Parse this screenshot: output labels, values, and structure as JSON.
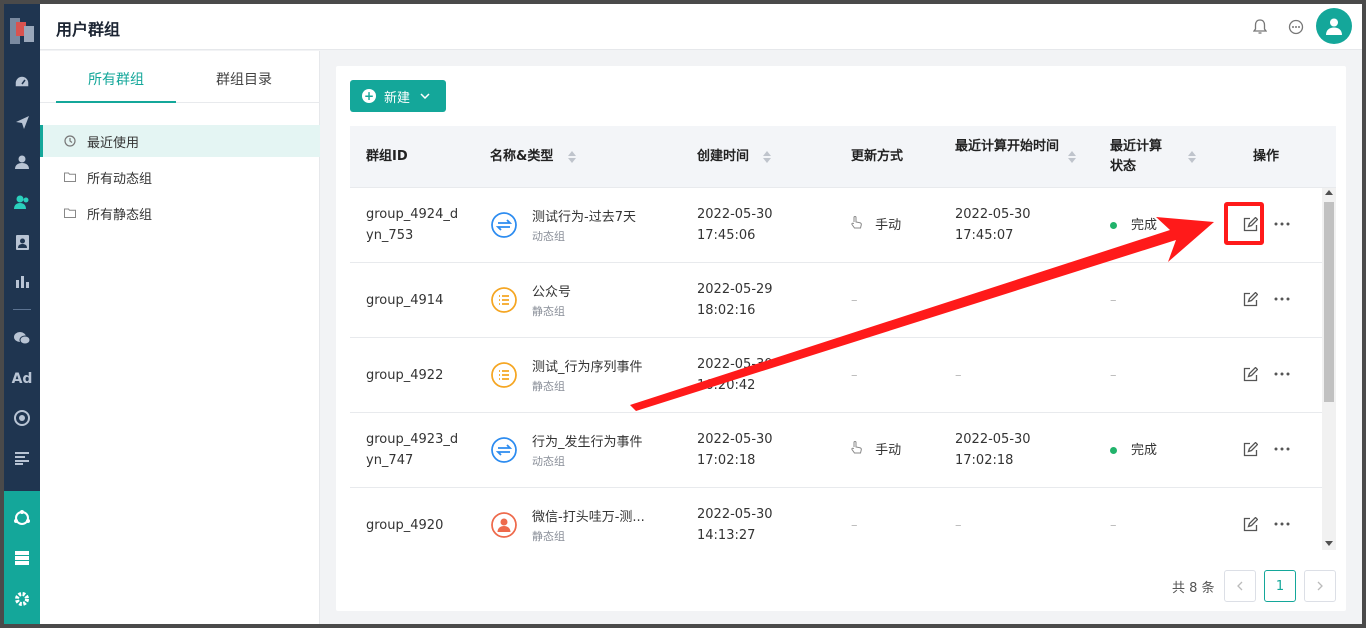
{
  "header": {
    "title": "用户群组"
  },
  "side": {
    "tabs": [
      {
        "label": "所有群组"
      },
      {
        "label": "群组目录"
      }
    ],
    "items": [
      {
        "label": "最近使用"
      },
      {
        "label": "所有动态组"
      },
      {
        "label": "所有静态组"
      }
    ]
  },
  "toolbar": {
    "new_label": "新建"
  },
  "table": {
    "headers": [
      "群组ID",
      "名称&类型",
      "创建时间",
      "更新方式",
      "最近计算开始时间",
      "最近计算状态",
      "操作"
    ],
    "rows": [
      {
        "id_l1": "group_4924_d",
        "id_l2": "yn_753",
        "name": "测试行为-过去7天",
        "type": "动态组",
        "icon": "sync-icon",
        "date": "2022-05-30",
        "time": "17:45:06",
        "update": "手动",
        "calc_date": "2022-05-30",
        "calc_time": "17:45:07",
        "status": "完成"
      },
      {
        "id_l1": "group_4914",
        "id_l2": "",
        "name": "公众号",
        "type": "静态组",
        "icon": "list-icon",
        "date": "2022-05-29",
        "time": "18:02:16",
        "update": "–",
        "calc_date": "–",
        "calc_time": "",
        "status": "–"
      },
      {
        "id_l1": "group_4922",
        "id_l2": "",
        "name": "测试_行为序列事件",
        "type": "静态组",
        "icon": "list-icon",
        "date": "2022-05-30",
        "time": "16:20:42",
        "update": "–",
        "calc_date": "–",
        "calc_time": "",
        "status": "–"
      },
      {
        "id_l1": "group_4923_d",
        "id_l2": "yn_747",
        "name": "行为_发生行为事件",
        "type": "动态组",
        "icon": "sync-icon",
        "date": "2022-05-30",
        "time": "17:02:18",
        "update": "手动",
        "calc_date": "2022-05-30",
        "calc_time": "17:02:18",
        "status": "完成"
      },
      {
        "id_l1": "group_4920",
        "id_l2": "",
        "name": "微信-打头哇万-测...",
        "type": "静态组",
        "icon": "person-icon",
        "date": "2022-05-30",
        "time": "14:13:27",
        "update": "–",
        "calc_date": "–",
        "calc_time": "",
        "status": "–"
      }
    ]
  },
  "pagination": {
    "total": "共 8 条",
    "current": "1"
  },
  "colors": {
    "accent": "#14a79a",
    "rail": "#1f3550",
    "highlight": "#ff1a1a",
    "success": "#21b36b"
  }
}
